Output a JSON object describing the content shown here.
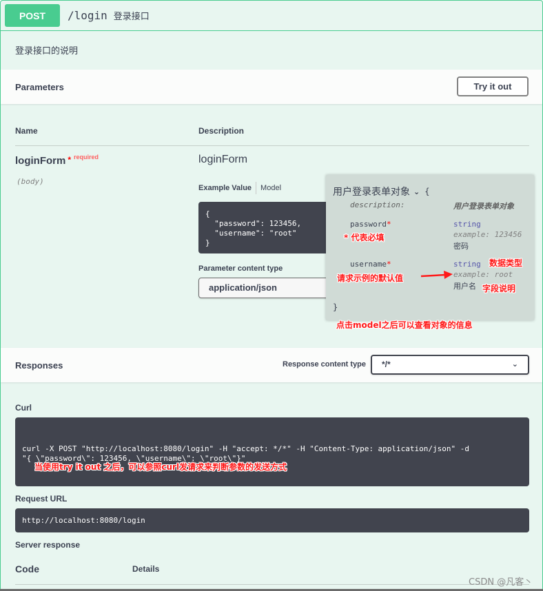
{
  "operation": {
    "method": "POST",
    "path": "/login",
    "summary": "登录接口",
    "description": "登录接口的说明"
  },
  "parameters": {
    "title": "Parameters",
    "try_button": "Try it out",
    "col_name": "Name",
    "col_description": "Description",
    "param": {
      "name": "loginForm",
      "required_star": "*",
      "required_label": "required",
      "in": "(body)",
      "description": "loginForm"
    },
    "tabs": {
      "example": "Example Value",
      "model": "Model"
    },
    "example_value": "{\n  \"password\": 123456,\n  \"username\": \"root\"\n}",
    "content_type_label": "Parameter content type",
    "content_type_value": "application/json"
  },
  "model": {
    "title": "用户登录表单对象",
    "chevron": "⌄",
    "open_brace": "{",
    "close_brace": "}",
    "description_key": "description:",
    "description_value": "用户登录表单对象",
    "fields": [
      {
        "name": "password",
        "star": "*",
        "type": "string",
        "example": "example: 123456",
        "desc": "密码"
      },
      {
        "name": "username",
        "star": "*",
        "type": "string",
        "example": "example: root",
        "desc": "用户名"
      }
    ]
  },
  "annotations": {
    "required_note": "* 代表必填",
    "default_value_note": "请求示例的默认值",
    "data_type_note": "数据类型",
    "field_desc_note": "字段说明",
    "model_note": "点击model之后可以查看对象的信息",
    "curl_note": "当使用try it out 之后，可以参照curl发请求来判断参数的发送方式",
    "accent_color": "#ff1a1a"
  },
  "responses": {
    "title": "Responses",
    "content_type_label": "Response content type",
    "content_type_value": "*/*",
    "curl_label": "Curl",
    "curl": "curl -X POST \"http://localhost:8080/login\" -H \"accept: */*\" -H \"Content-Type: application/json\" -d\n\"{ \\\"password\\\": 123456, \\\"username\\\": \\\"root\\\"}\"",
    "request_url_label": "Request URL",
    "request_url": "http://localhost:8080/login",
    "server_response_label": "Server response",
    "code_header": "Code",
    "details_header": "Details"
  },
  "watermark": "CSDN @凡客丶",
  "colors": {
    "post_green": "#49cc90",
    "block_bg": "#e8f6f0",
    "code_bg": "#41444e",
    "text": "#3b4151"
  }
}
